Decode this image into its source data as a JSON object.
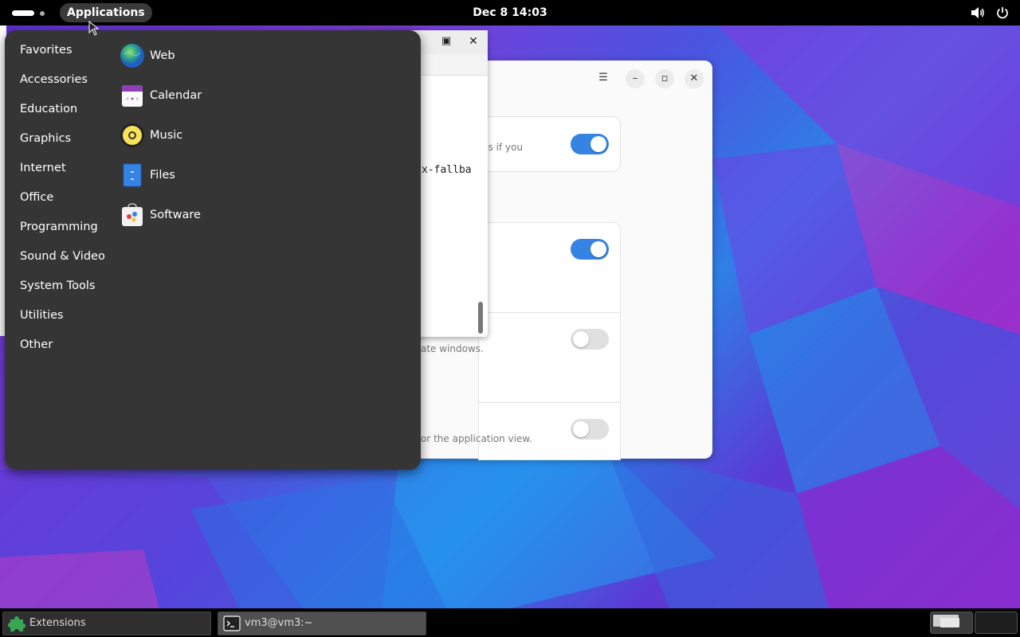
{
  "top_bar": {
    "activities_icon": "activities-icon",
    "applications_label": "Applications",
    "clock": "Dec 8  14:03",
    "status_icons": [
      "volume-icon",
      "power-icon"
    ]
  },
  "apps_menu": {
    "categories": [
      "Favorites",
      "Accessories",
      "Education",
      "Graphics",
      "Internet",
      "Office",
      "Programming",
      "Sound & Video",
      "System Tools",
      "Utilities",
      "Other"
    ],
    "apps": [
      {
        "label": "Web",
        "icon": "web-browser-icon"
      },
      {
        "label": "Calendar",
        "icon": "calendar-icon"
      },
      {
        "label": "Music",
        "icon": "music-icon"
      },
      {
        "label": "Files",
        "icon": "files-icon"
      },
      {
        "label": "Software",
        "icon": "software-icon"
      }
    ]
  },
  "terminal": {
    "visible_text": "x-fallba"
  },
  "settings": {
    "desc_1": "ns if you",
    "desc_3": "ate windows.",
    "desc_4": "or the application view.",
    "toggles": [
      true,
      true,
      false,
      false
    ]
  },
  "taskbar": {
    "items": [
      {
        "label": "Extensions",
        "icon": "extensions-puzzle-icon"
      },
      {
        "label": "vm3@vm3:~",
        "icon": "terminal-icon"
      }
    ],
    "workspaces": 2,
    "current_workspace": 1
  },
  "colors": {
    "accent": "#3584e4",
    "menu_bg": "#353535",
    "top_bar_bg": "#000000"
  }
}
